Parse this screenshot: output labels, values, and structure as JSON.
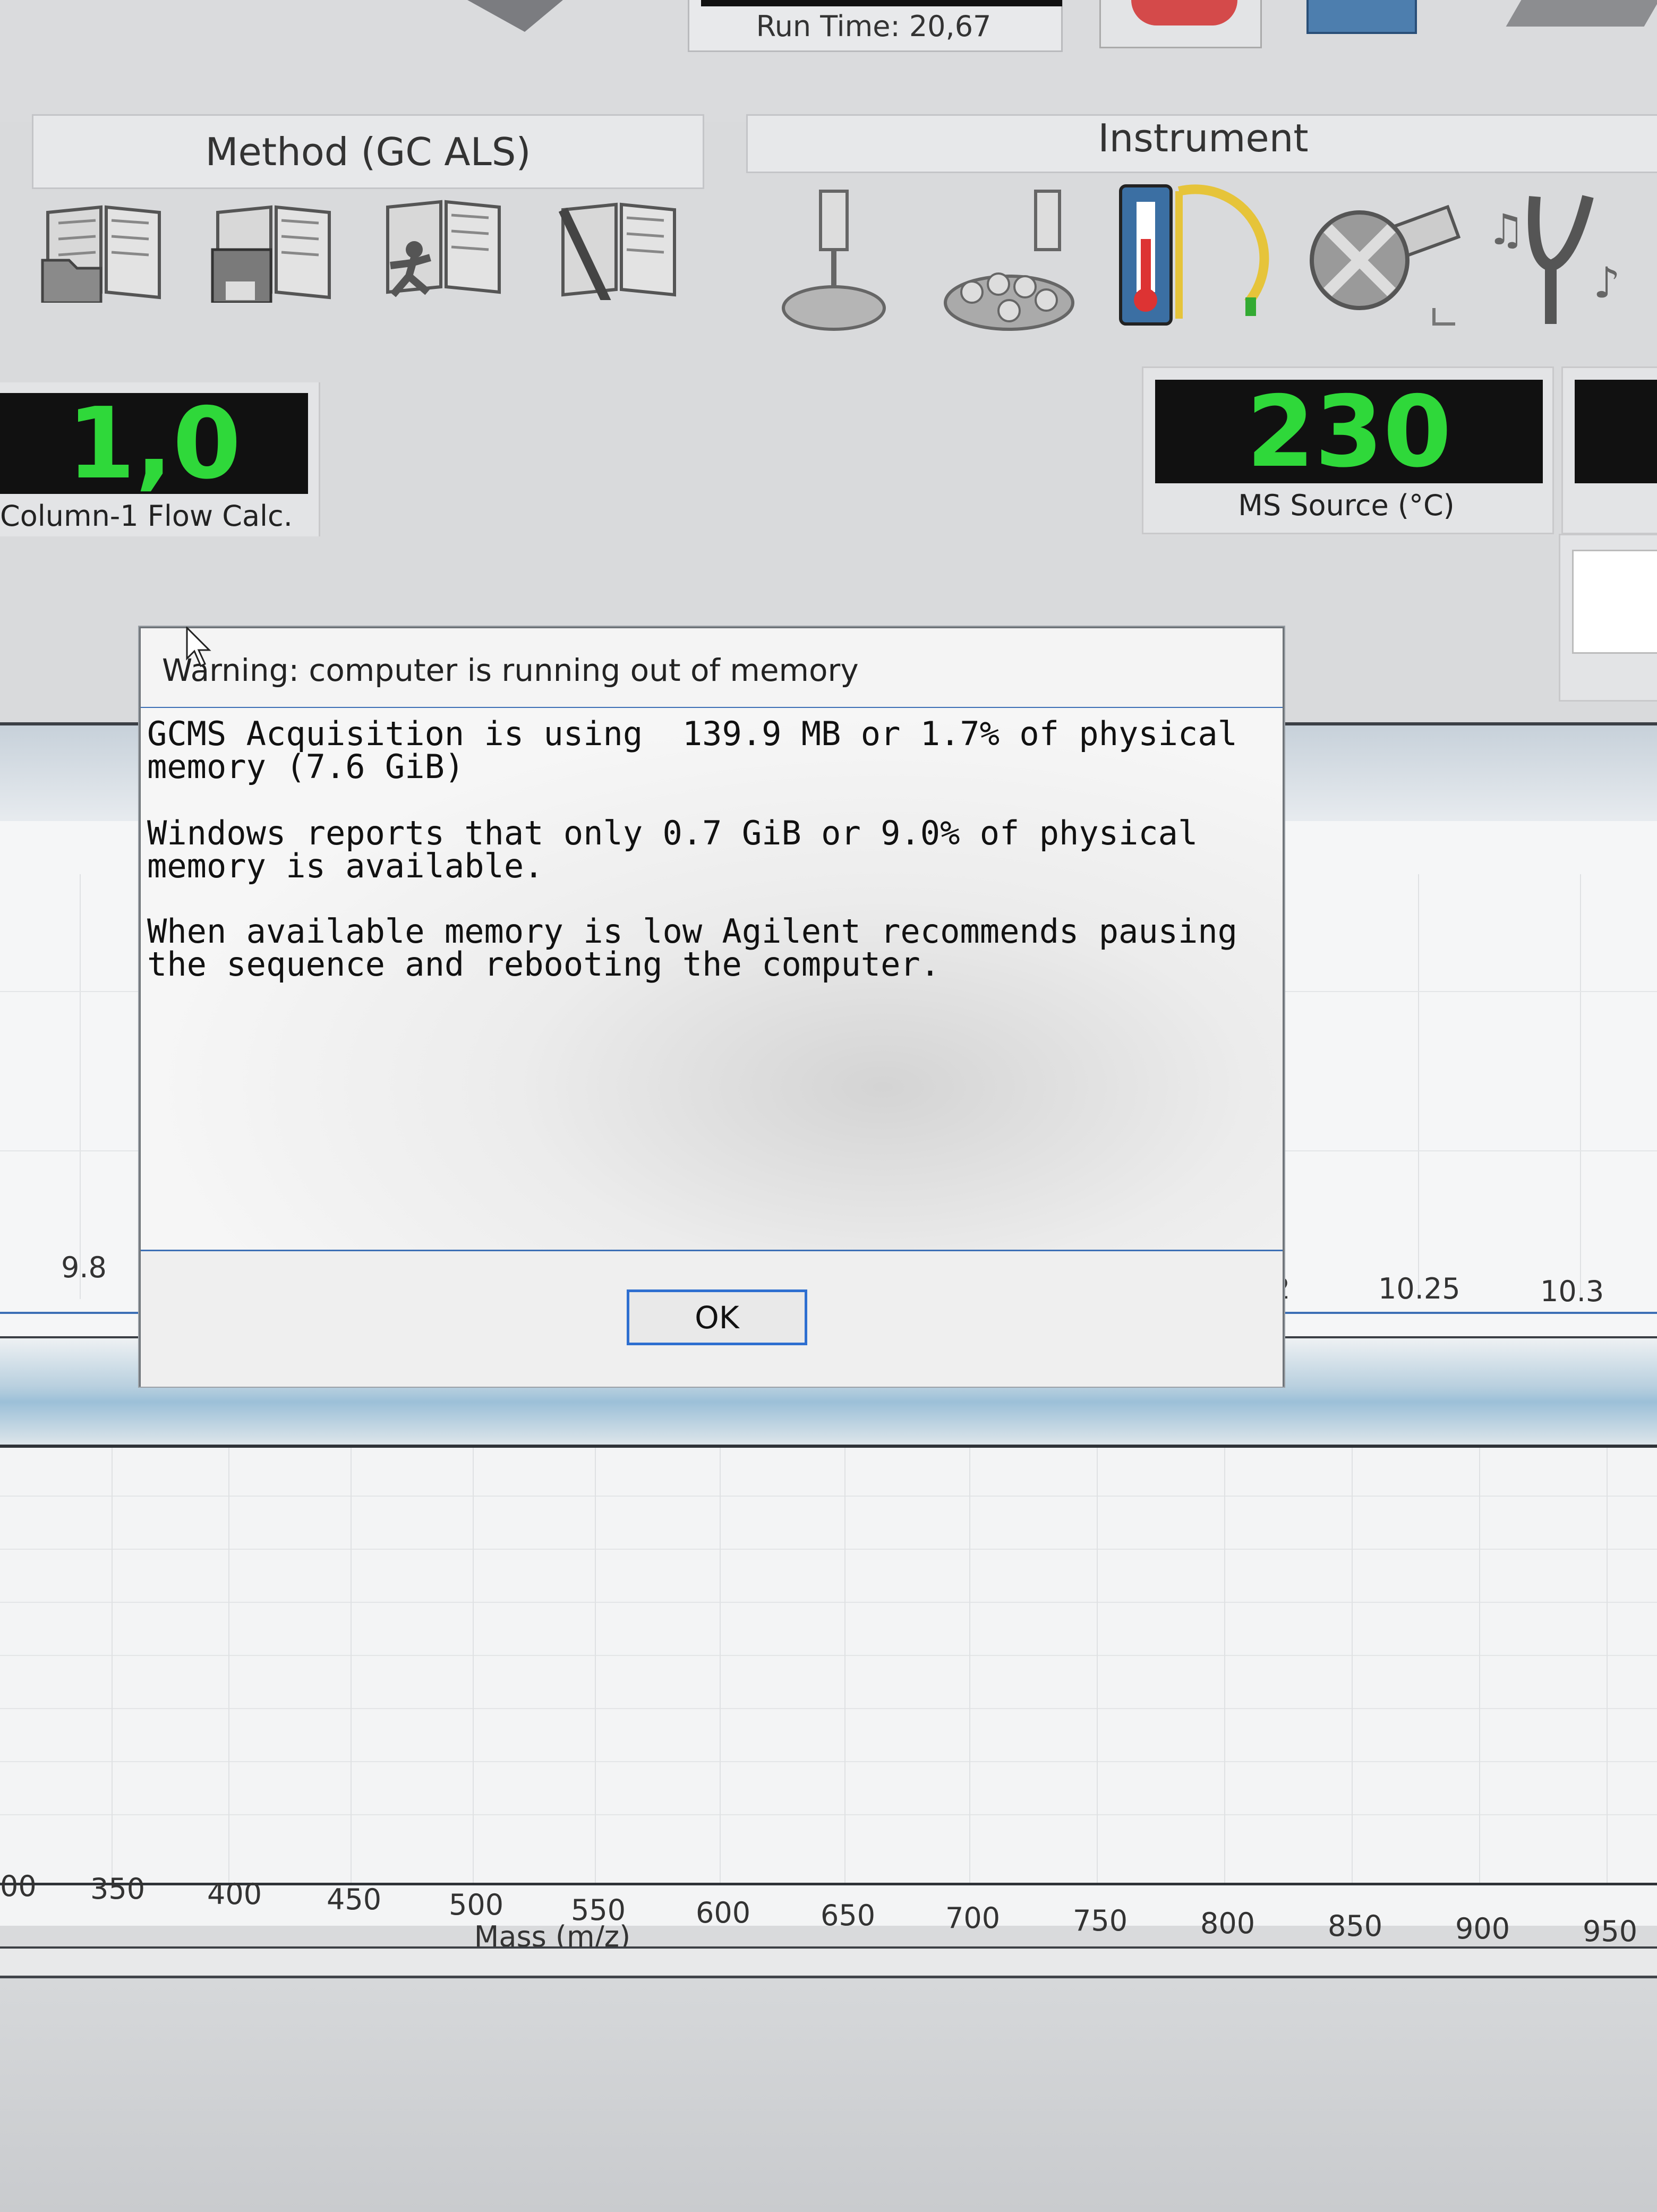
{
  "toolbar": {
    "run_time": "Run Time: 20,67"
  },
  "groups": {
    "method_title": "Method (GC ALS)",
    "instrument_title": "Instrument"
  },
  "icons": {
    "method": [
      "open-method-icon",
      "save-method-icon",
      "run-method-icon",
      "edit-method-icon"
    ],
    "instrument": [
      "injector-icon",
      "autosampler-tray-icon",
      "temperature-icon",
      "ms-source-icon",
      "tune-icon"
    ]
  },
  "readouts": {
    "column_flow_value": "1,0",
    "column_flow_label": "Column-1 Flow Calc.",
    "ms_source_value": "230",
    "ms_source_label": "MS Source (°C)",
    "readout_color": "#2fd83a"
  },
  "chart_top": {
    "x_ticks": [
      "9.8",
      "2",
      "10.25",
      "10.3"
    ]
  },
  "chart_bottom": {
    "x_ticks": [
      "00",
      "350",
      "400",
      "450",
      "500",
      "550",
      "600",
      "650",
      "700",
      "750",
      "800",
      "850",
      "900",
      "950"
    ],
    "xlabel": "Mass (m/z)"
  },
  "dialog": {
    "title": "Warning: computer is running out of memory",
    "lines": [
      "GCMS Acquisition is using  139.9 MB or 1.7% of physical",
      "memory (7.6 GiB)",
      "Windows reports that only 0.7 GiB or 9.0% of physical",
      "memory is available.",
      "When available memory is low Agilent recommends pausing",
      "the sequence and rebooting the computer."
    ],
    "ok_label": "OK"
  }
}
